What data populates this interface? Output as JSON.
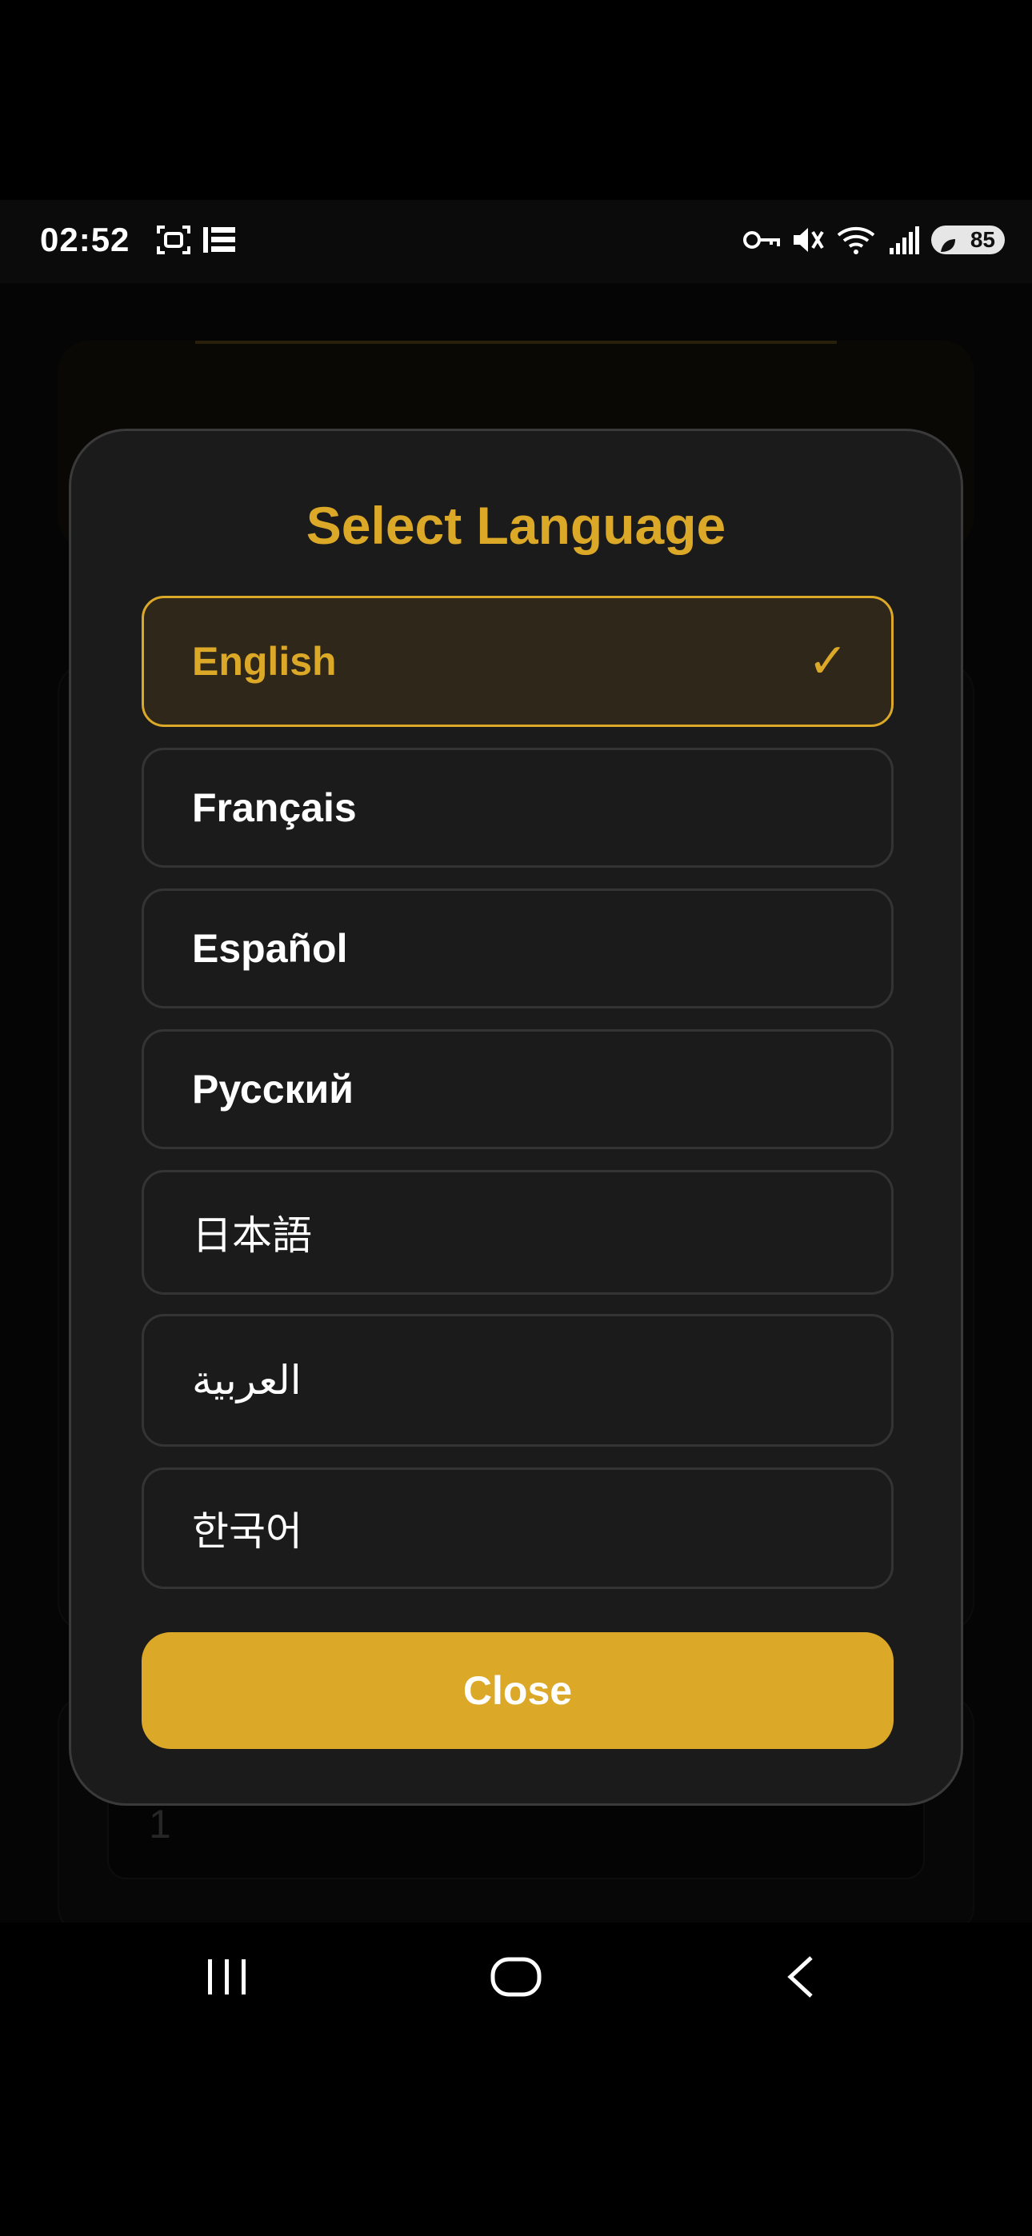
{
  "status_bar": {
    "time": "02:52",
    "battery": "85",
    "icons": [
      "screenshot-icon",
      "list-icon",
      "vpn-key-icon",
      "mute-icon",
      "wifi-icon",
      "signal-icon",
      "battery-icon"
    ]
  },
  "background": {
    "input_value": "1"
  },
  "modal": {
    "title": "Select Language",
    "selected_language": "English",
    "languages": [
      {
        "label": "English",
        "selected": true
      },
      {
        "label": "Français",
        "selected": false
      },
      {
        "label": "Español",
        "selected": false
      },
      {
        "label": "Русский",
        "selected": false
      },
      {
        "label": "日本語",
        "selected": false
      },
      {
        "label": "العربية",
        "selected": false
      },
      {
        "label": "한국어",
        "selected": false
      }
    ],
    "check_icon": "✓",
    "close_label": "Close"
  },
  "nav_bar": {
    "icons": [
      "recent-apps-icon",
      "home-icon",
      "back-icon"
    ]
  },
  "colors": {
    "accent": "#dca827",
    "modal_bg": "#1b1b1b",
    "selected_bg": "#2f271a",
    "option_border": "#343434"
  }
}
